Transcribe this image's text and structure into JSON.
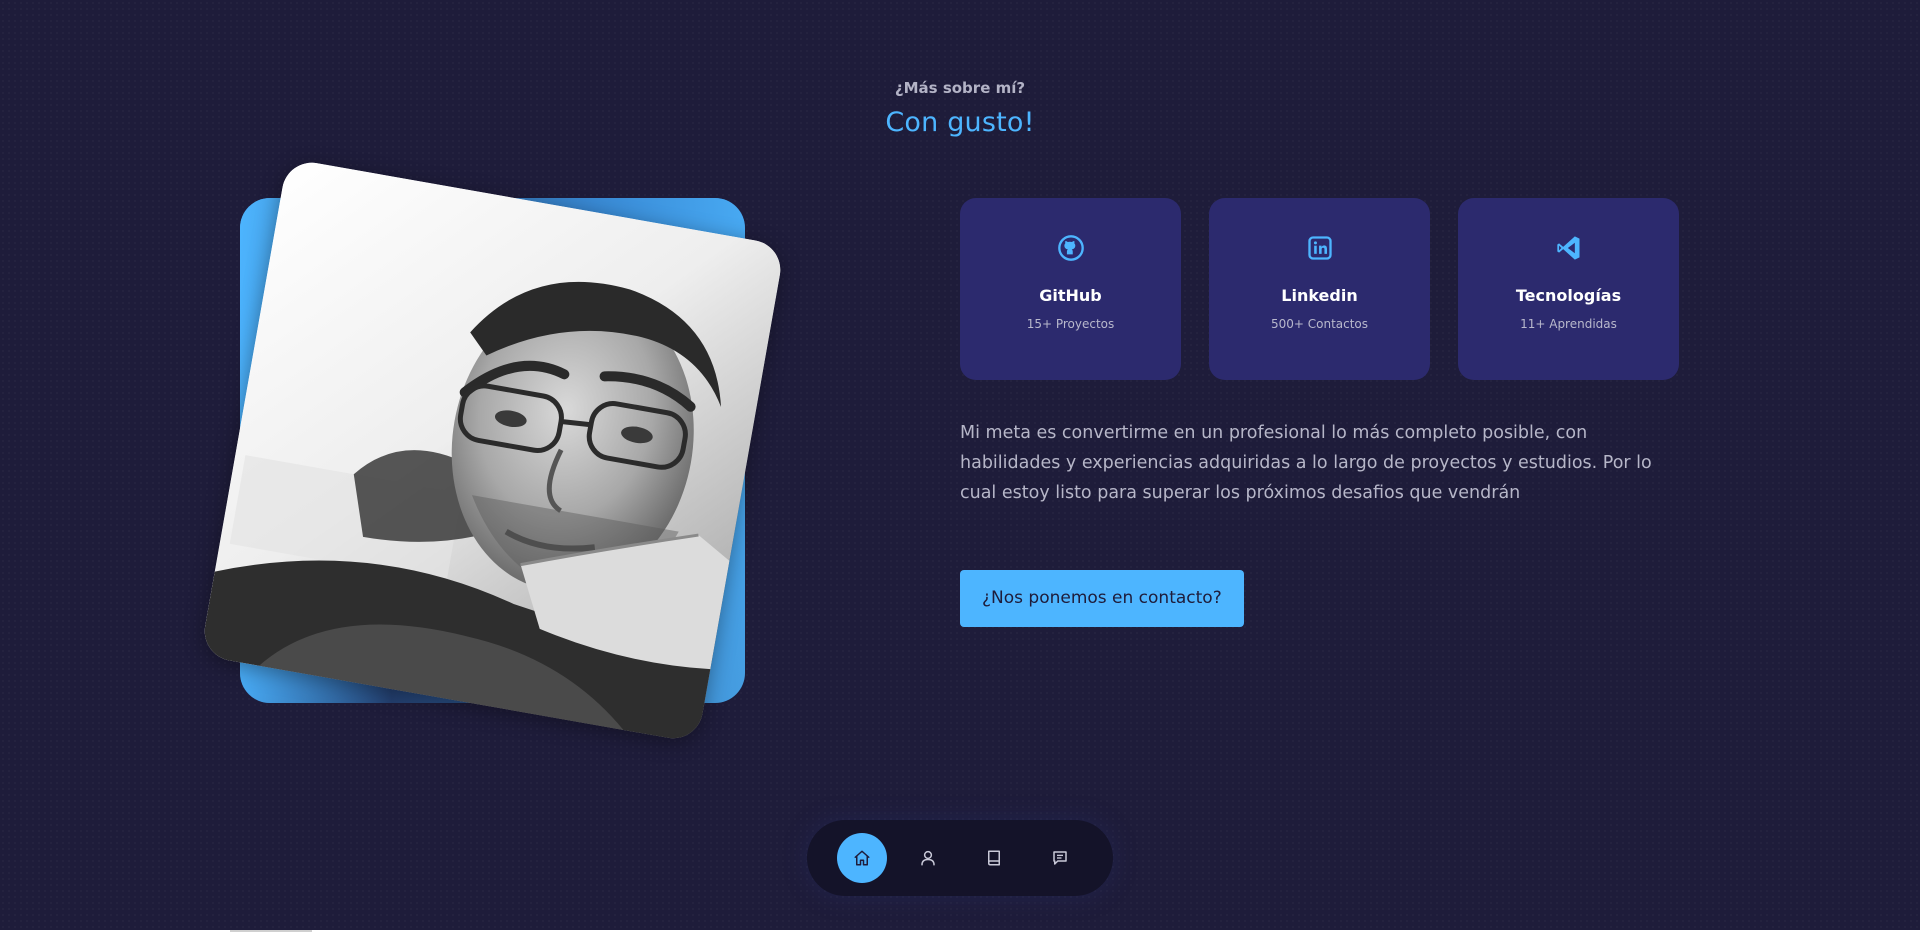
{
  "header": {
    "subtitle": "¿Más sobre mí?",
    "title": "Con gusto!"
  },
  "colors": {
    "background": "#1e1c3a",
    "accent": "#4db5ff",
    "card": "#2c2a6e",
    "nav": "#141329"
  },
  "photo": {
    "alt": "profile-photo"
  },
  "cards": [
    {
      "icon": "github-icon",
      "title": "GitHub",
      "subtitle": "15+ Proyectos"
    },
    {
      "icon": "linkedin-icon",
      "title": "Linkedin",
      "subtitle": "500+ Contactos"
    },
    {
      "icon": "vscode-icon",
      "title": "Tecnologías",
      "subtitle": "11+ Aprendidas"
    }
  ],
  "about": {
    "text": "Mi meta es convertirme en un profesional lo más completo posible, con habilidades y experiencias adquiridas a lo largo de proyectos y estudios. Por lo cual estoy listo para superar los próximos desafios que vendrán",
    "cta_label": "¿Nos ponemos en contacto?"
  },
  "nav": {
    "items": [
      {
        "icon": "home-icon",
        "active": true
      },
      {
        "icon": "user-icon",
        "active": false
      },
      {
        "icon": "book-icon",
        "active": false
      },
      {
        "icon": "message-icon",
        "active": false
      }
    ]
  }
}
